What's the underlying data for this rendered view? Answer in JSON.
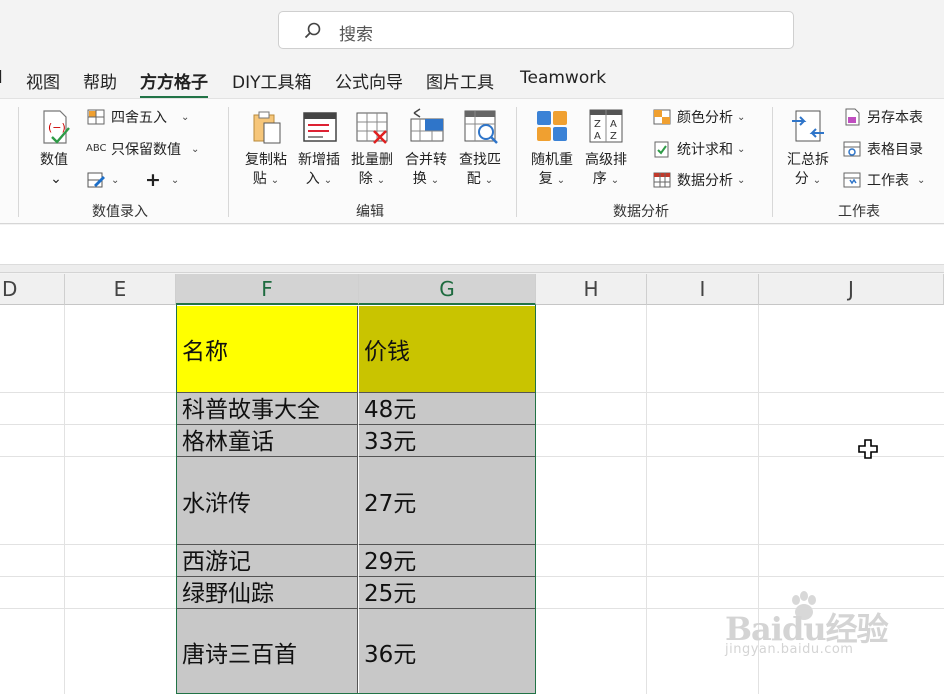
{
  "search": {
    "placeholder": "搜索"
  },
  "menu": {
    "partial_left": "l",
    "tabs": [
      {
        "label": "视图"
      },
      {
        "label": "帮助"
      },
      {
        "label": "方方格子",
        "active": true
      },
      {
        "label": "DIY工具箱"
      },
      {
        "label": "公式向导"
      },
      {
        "label": "图片工具"
      },
      {
        "label": "Teamwork"
      }
    ]
  },
  "ribbon": {
    "groups": {
      "numeric": {
        "label": "数值录入",
        "big_value": "数值",
        "round": "四舍五入",
        "keep_value": "只保留数值",
        "plus": "+"
      },
      "edit": {
        "label": "编辑",
        "copy_paste": [
          "复制粘",
          "贴"
        ],
        "add_insert": [
          "新增插",
          "入"
        ],
        "batch_delete": [
          "批量删",
          "除"
        ],
        "merge_convert": [
          "合并转",
          "换"
        ],
        "find_match": [
          "查找匹",
          "配"
        ]
      },
      "analysis": {
        "label": "数据分析",
        "random_repeat": [
          "随机重",
          "复"
        ],
        "advanced_sort": [
          "高级排",
          "序"
        ],
        "color_analysis": "颜色分析",
        "stats_sum": "统计求和",
        "data_analysis": "数据分析"
      },
      "sheet": {
        "label": "工作表",
        "summary_split": [
          "汇总拆",
          "分"
        ],
        "save_sheet": "另存本表",
        "sheet_catalog": "表格目录",
        "worksheet": "工作表"
      }
    }
  },
  "grid": {
    "columns": [
      "D",
      "E",
      "F",
      "G",
      "H",
      "I",
      "J"
    ],
    "selected_columns": [
      "F",
      "G"
    ],
    "header": {
      "name": "名称",
      "price": "价钱"
    },
    "rows": [
      {
        "name": "科普故事大全",
        "price": "48元"
      },
      {
        "name": "格林童话",
        "price": "33元"
      },
      {
        "name": "水浒传",
        "price": "27元"
      },
      {
        "name": "西游记",
        "price": "29元"
      },
      {
        "name": "绿野仙踪",
        "price": "25元"
      },
      {
        "name": "唐诗三百首",
        "price": "36元"
      }
    ]
  },
  "watermark": {
    "brand": "Baidu经验",
    "url": "jingyan.baidu.com"
  },
  "colors": {
    "accent": "#217346",
    "header_name_fill": "#ffff00",
    "header_price_fill": "#c9c400",
    "data_fill": "#c8c8c8"
  }
}
